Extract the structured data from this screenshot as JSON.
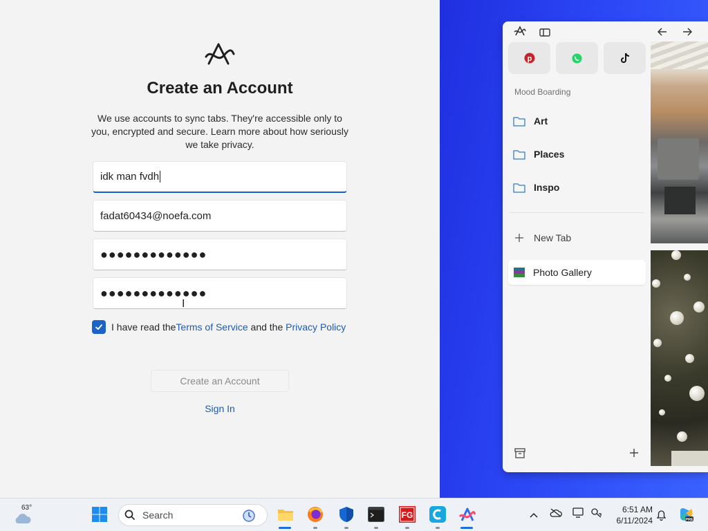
{
  "signup": {
    "title": "Create an Account",
    "description": "We use accounts to sync tabs. They're accessible only to you, encrypted and secure. Learn more about how seriously we take privacy.",
    "name_value": "idk man fvdh",
    "email_value": "fadat60434@noefa.com",
    "password_masked": "●●●●●●●●●●●●●",
    "confirm_masked": "●●●●●●●●●●●●●",
    "terms_prefix": "I have read the ",
    "terms_link": "Terms of Service",
    "terms_middle": " and the ",
    "privacy_link": "Privacy Policy",
    "terms_checked": true,
    "create_button": "Create an Account",
    "signin_link": "Sign In"
  },
  "browser": {
    "favorites": [
      "pinterest-icon",
      "whatsapp-icon",
      "tiktok-icon"
    ],
    "section_label": "Mood Boarding",
    "folders": [
      "Art",
      "Places",
      "Inspo"
    ],
    "new_tab_label": "New Tab",
    "open_tab": "Photo Gallery"
  },
  "taskbar": {
    "weather_temp": "63°",
    "search_placeholder": "Search",
    "time": "6:51 AM",
    "date": "6/11/2024",
    "apps": [
      "file-explorer",
      "firefox",
      "defender",
      "terminal",
      "fg-app",
      "c-app",
      "arc-browser"
    ]
  },
  "colors": {
    "accent": "#1d63c7",
    "link": "#1a5bb5",
    "desktop_blue": "#2b46f5"
  }
}
